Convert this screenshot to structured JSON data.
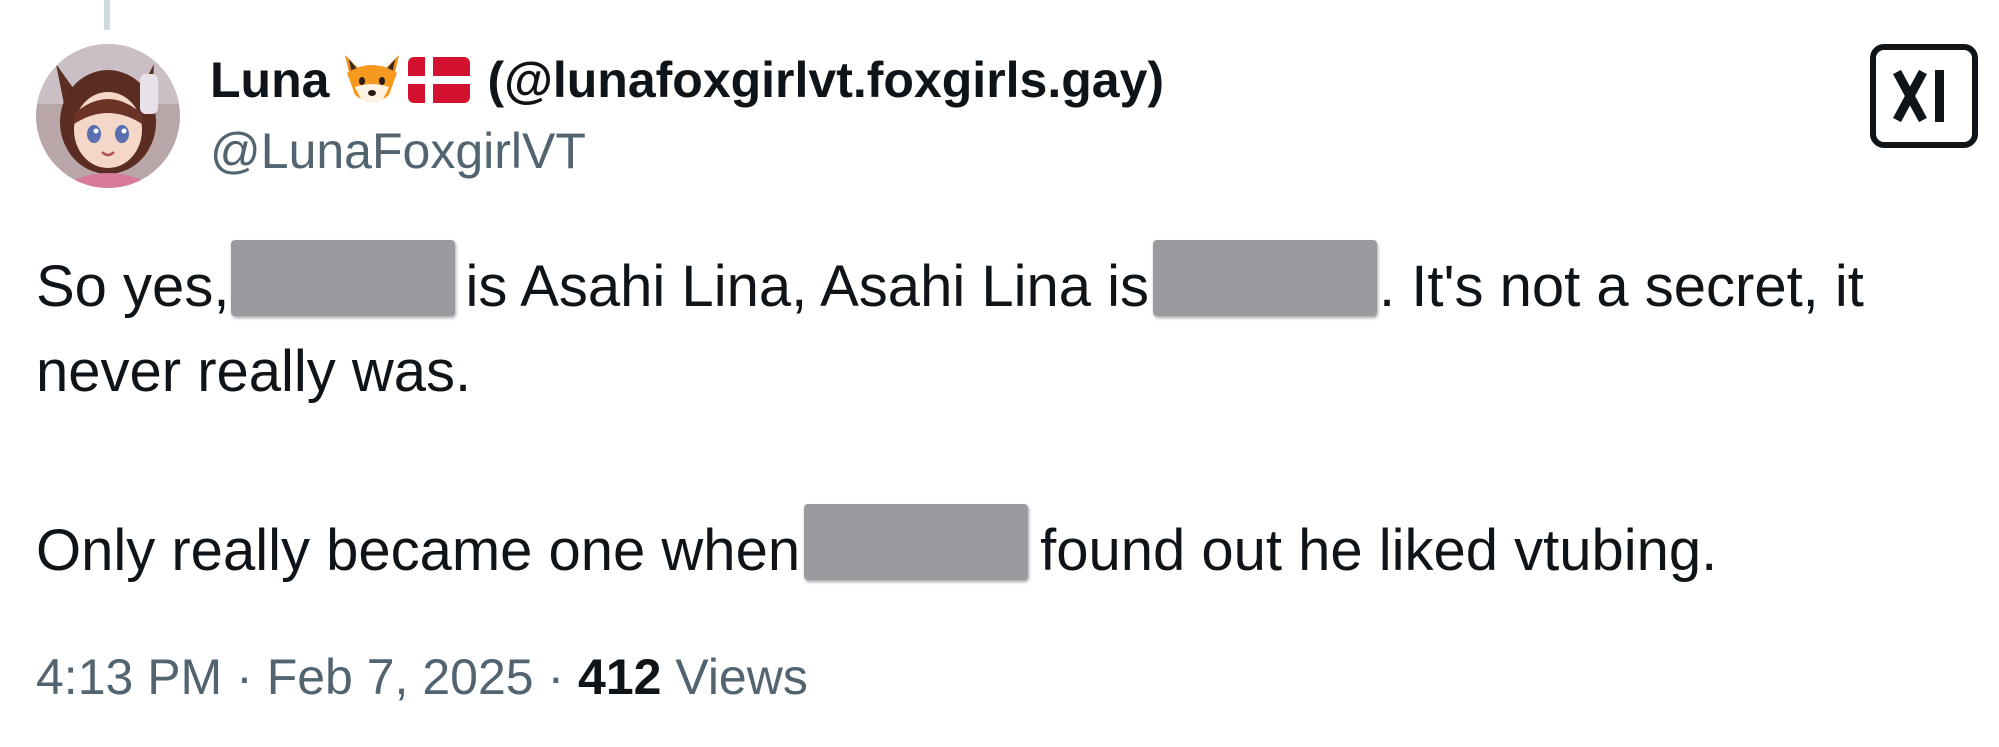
{
  "author": {
    "display_name": "Luna",
    "emojis": [
      "fox-face-emoji",
      "denmark-flag-emoji"
    ],
    "alt_handle": "(@lunafoxgirlvt.foxgirls.gay)",
    "handle": "@LunaFoxgirlVT"
  },
  "tweet": {
    "line1_a": "So yes,",
    "line1_b": "is Asahi Lina, Asahi Lina is",
    "line1_c": ". It's not a secret, it",
    "line2": "never really was.",
    "line3_a": "Only really became one when",
    "line3_b": "found out he liked vtubing."
  },
  "meta": {
    "time": "4:13 PM",
    "separator": "·",
    "date": "Feb 7, 2025",
    "views_count": "412",
    "views_label": "Views"
  },
  "icons": {
    "brand": "x-logo-icon",
    "redaction_color": "#9b9aa0"
  },
  "colors": {
    "text": "#0f1419",
    "secondary": "#536471",
    "thread_line": "#cfd9de"
  }
}
